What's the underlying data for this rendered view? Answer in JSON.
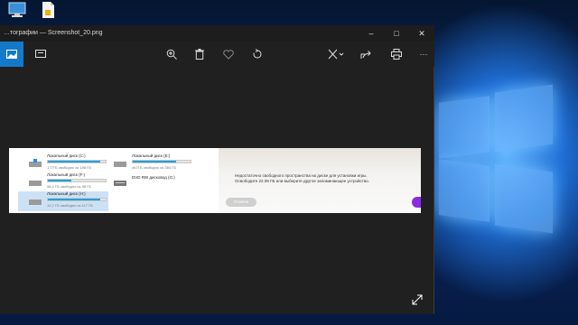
{
  "window": {
    "title": "…тографии — Screenshot_20.png",
    "controls": [
      "–",
      "□",
      "✕"
    ]
  },
  "toolbar": {
    "icons": [
      "photo-icon",
      "slideshow-icon",
      "zoom-icon",
      "delete-icon",
      "heart-icon",
      "rotate-icon",
      "edit-icon",
      "share-icon",
      "print-icon",
      "more-icon"
    ],
    "more_label": "···"
  },
  "photo": {
    "drives": [
      {
        "name": "Локальный диск (C:)",
        "free": "177ГБ свободно из 198 ГБ",
        "fill": 0.9
      },
      {
        "name": "Локальный диск (E:)",
        "free": "467ГБ свободно из 384 ГБ",
        "fill": 0.75
      },
      {
        "name": "Локальный диск (F:)",
        "free": "58,4 ГБ свободно из 98 ГБ",
        "fill": 0.4
      },
      {
        "name": "DVD RW дисковод (G:)",
        "free": "",
        "fill": 0
      },
      {
        "name": "Локальный диск (H:)",
        "free": "12,2 ГБ свободно из 117 ГБ",
        "fill": 0.9
      }
    ],
    "notice": "Недостаточно свободного пространства на диске для установки игры. Освободите 22.09 ГБ или выберите другое запоминающее устройство.",
    "cancel_label": "Отмена"
  },
  "colors": {
    "accent": "#1479c9",
    "drive_bar": "#26a0da",
    "window_bg": "#202020"
  }
}
